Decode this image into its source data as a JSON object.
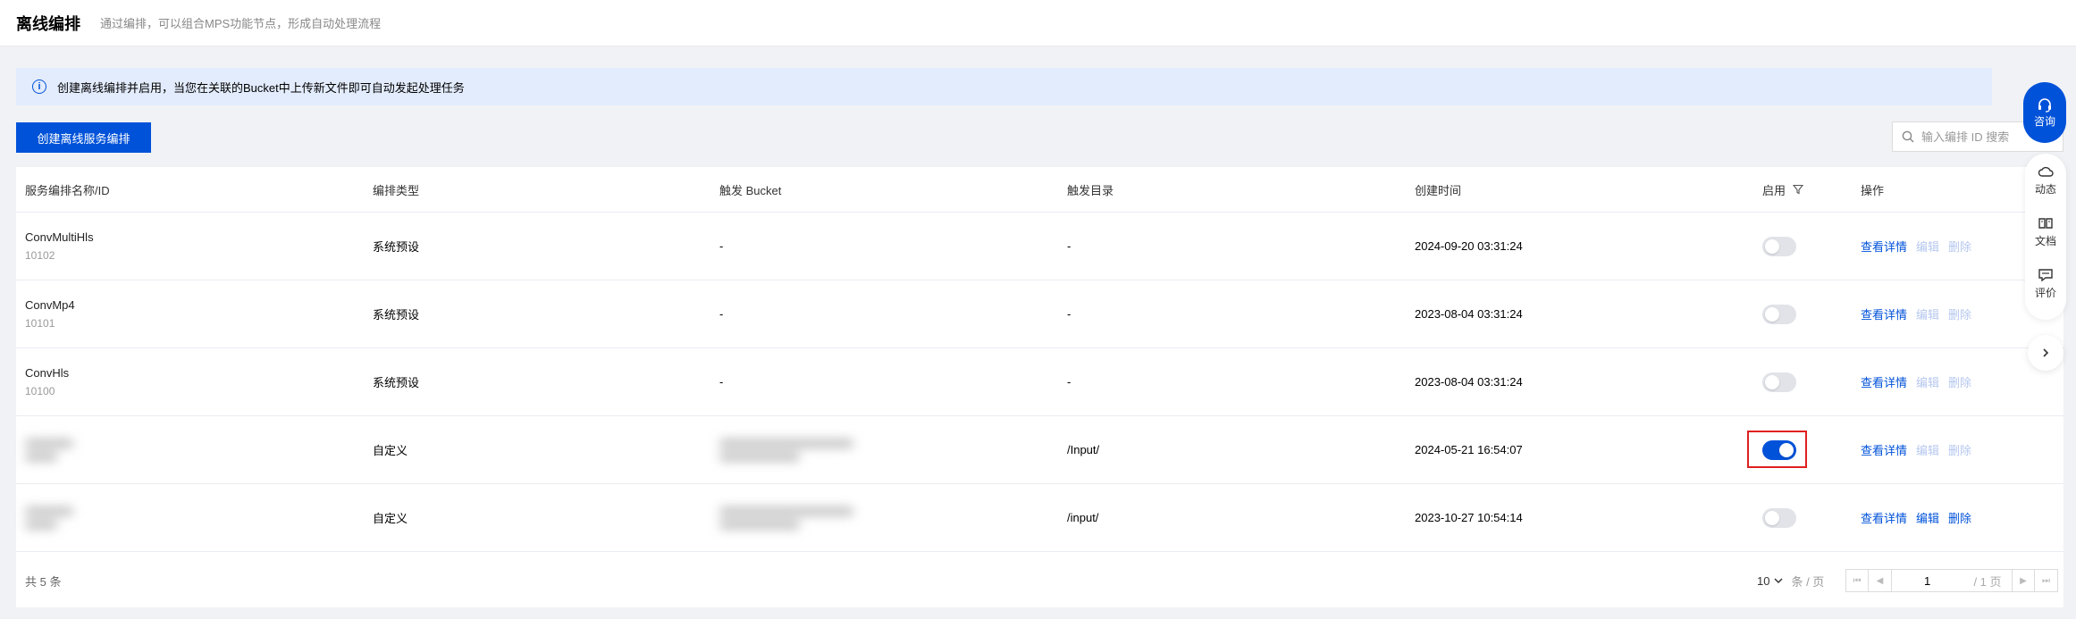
{
  "header": {
    "title": "离线编排",
    "subtitle": "通过编排，可以组合MPS功能节点，形成自动处理流程"
  },
  "banner": {
    "icon": "info-icon",
    "text": "创建离线编排并启用，当您在关联的Bucket中上传新文件即可自动发起处理任务"
  },
  "toolbar": {
    "create_label": "创建离线服务编排",
    "search_placeholder": "输入编排 ID 搜索"
  },
  "table": {
    "columns": [
      "服务编排名称/ID",
      "编排类型",
      "触发 Bucket",
      "触发目录",
      "创建时间",
      "启用",
      "操作"
    ],
    "rows": [
      {
        "name": "ConvMultiHls",
        "id": "10102",
        "type": "系统预设",
        "bucket": "-",
        "dir": "-",
        "created": "2024-09-20 03:31:24",
        "enabled": false,
        "ops": [
          "查看详情",
          "编辑",
          "删除"
        ],
        "ops_disabled": [
          false,
          true,
          true
        ],
        "redacted": false
      },
      {
        "name": "ConvMp4",
        "id": "10101",
        "type": "系统预设",
        "bucket": "-",
        "dir": "-",
        "created": "2023-08-04 03:31:24",
        "enabled": false,
        "ops": [
          "查看详情",
          "编辑",
          "删除"
        ],
        "ops_disabled": [
          false,
          true,
          true
        ],
        "redacted": false
      },
      {
        "name": "ConvHls",
        "id": "10100",
        "type": "系统预设",
        "bucket": "-",
        "dir": "-",
        "created": "2023-08-04 03:31:24",
        "enabled": false,
        "ops": [
          "查看详情",
          "编辑",
          "删除"
        ],
        "ops_disabled": [
          false,
          true,
          true
        ],
        "redacted": false
      },
      {
        "name": "",
        "id": "",
        "type": "自定义",
        "bucket": "",
        "dir": "/Input/",
        "created": "2024-05-21 16:54:07",
        "enabled": true,
        "ops": [
          "查看详情",
          "编辑",
          "删除"
        ],
        "ops_disabled": [
          false,
          true,
          true
        ],
        "redacted": true
      },
      {
        "name": "",
        "id": "",
        "type": "自定义",
        "bucket": "",
        "dir": "/input/",
        "created": "2023-10-27 10:54:14",
        "enabled": false,
        "ops": [
          "查看详情",
          "编辑",
          "删除"
        ],
        "ops_disabled": [
          false,
          false,
          false
        ],
        "redacted": true
      }
    ]
  },
  "footer": {
    "total": "共 5 条",
    "page_size": "10",
    "page_size_unit": "条 / 页",
    "current_page": "1",
    "total_pages": "/ 1 页"
  },
  "sidebar": {
    "consult": "咨询",
    "items": [
      {
        "label": "动态",
        "icon": "cloud-icon"
      },
      {
        "label": "文档",
        "icon": "book-icon"
      },
      {
        "label": "评价",
        "icon": "comment-icon"
      }
    ],
    "collapse_icon": "chevron-right-icon"
  },
  "colors": {
    "primary": "#0052d9",
    "banner_bg": "#e3ecfd",
    "disabled_link": "#b5c7ef",
    "highlight": "#e02020"
  }
}
